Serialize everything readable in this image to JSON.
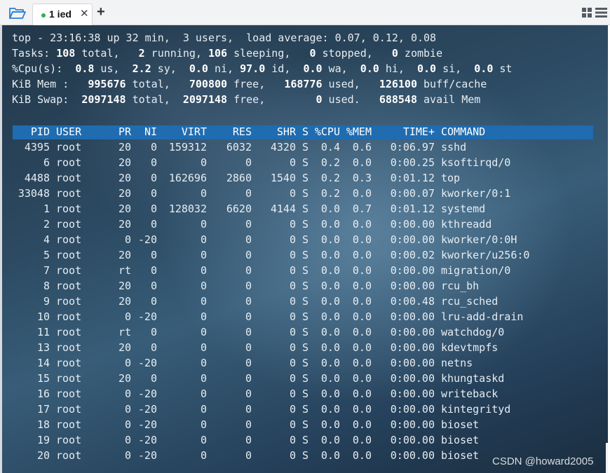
{
  "tabbar": {
    "open_folder_icon": "folder-open-icon",
    "tab_label": "1 ied",
    "tab_close_glyph": "✕",
    "add_tab_glyph": "+",
    "layout_icon": "grid-list-icon",
    "colors": {
      "tab_dot": "#2cb34a",
      "folder_icon": "#2a7fd4"
    }
  },
  "terminal": {
    "summary": [
      "top - 23:16:38 up 32 min,  3 users,  load average: 0.07, 0.12, 0.08",
      "Tasks: 108 total,   2 running, 106 sleeping,   0 stopped,   0 zombie",
      "%Cpu(s):  0.8 us,  2.2 sy,  0.0 ni, 97.0 id,  0.0 wa,  0.0 hi,  0.0 si,  0.0 st",
      "KiB Mem :   995676 total,   700800 free,   168776 used,   126100 buff/cache",
      "KiB Swap:  2097148 total,  2097148 free,        0 used.   688548 avail Mem"
    ],
    "columns": [
      "PID",
      "USER",
      "PR",
      "NI",
      "VIRT",
      "RES",
      "SHR",
      "S",
      "%CPU",
      "%MEM",
      "TIME+",
      "COMMAND"
    ],
    "processes": [
      [
        "4395",
        "root",
        "20",
        "0",
        "159312",
        "6032",
        "4320",
        "S",
        "0.4",
        "0.6",
        "0:06.97",
        "sshd"
      ],
      [
        "6",
        "root",
        "20",
        "0",
        "0",
        "0",
        "0",
        "S",
        "0.2",
        "0.0",
        "0:00.25",
        "ksoftirqd/0"
      ],
      [
        "4488",
        "root",
        "20",
        "0",
        "162696",
        "2860",
        "1540",
        "S",
        "0.2",
        "0.3",
        "0:01.12",
        "top"
      ],
      [
        "33048",
        "root",
        "20",
        "0",
        "0",
        "0",
        "0",
        "S",
        "0.2",
        "0.0",
        "0:00.07",
        "kworker/0:1"
      ],
      [
        "1",
        "root",
        "20",
        "0",
        "128032",
        "6620",
        "4144",
        "S",
        "0.0",
        "0.7",
        "0:01.12",
        "systemd"
      ],
      [
        "2",
        "root",
        "20",
        "0",
        "0",
        "0",
        "0",
        "S",
        "0.0",
        "0.0",
        "0:00.00",
        "kthreadd"
      ],
      [
        "4",
        "root",
        "0",
        "-20",
        "0",
        "0",
        "0",
        "S",
        "0.0",
        "0.0",
        "0:00.00",
        "kworker/0:0H"
      ],
      [
        "5",
        "root",
        "20",
        "0",
        "0",
        "0",
        "0",
        "S",
        "0.0",
        "0.0",
        "0:00.02",
        "kworker/u256:0"
      ],
      [
        "7",
        "root",
        "rt",
        "0",
        "0",
        "0",
        "0",
        "S",
        "0.0",
        "0.0",
        "0:00.00",
        "migration/0"
      ],
      [
        "8",
        "root",
        "20",
        "0",
        "0",
        "0",
        "0",
        "S",
        "0.0",
        "0.0",
        "0:00.00",
        "rcu_bh"
      ],
      [
        "9",
        "root",
        "20",
        "0",
        "0",
        "0",
        "0",
        "S",
        "0.0",
        "0.0",
        "0:00.48",
        "rcu_sched"
      ],
      [
        "10",
        "root",
        "0",
        "-20",
        "0",
        "0",
        "0",
        "S",
        "0.0",
        "0.0",
        "0:00.00",
        "lru-add-drain"
      ],
      [
        "11",
        "root",
        "rt",
        "0",
        "0",
        "0",
        "0",
        "S",
        "0.0",
        "0.0",
        "0:00.00",
        "watchdog/0"
      ],
      [
        "13",
        "root",
        "20",
        "0",
        "0",
        "0",
        "0",
        "S",
        "0.0",
        "0.0",
        "0:00.00",
        "kdevtmpfs"
      ],
      [
        "14",
        "root",
        "0",
        "-20",
        "0",
        "0",
        "0",
        "S",
        "0.0",
        "0.0",
        "0:00.00",
        "netns"
      ],
      [
        "15",
        "root",
        "20",
        "0",
        "0",
        "0",
        "0",
        "S",
        "0.0",
        "0.0",
        "0:00.00",
        "khungtaskd"
      ],
      [
        "16",
        "root",
        "0",
        "-20",
        "0",
        "0",
        "0",
        "S",
        "0.0",
        "0.0",
        "0:00.00",
        "writeback"
      ],
      [
        "17",
        "root",
        "0",
        "-20",
        "0",
        "0",
        "0",
        "S",
        "0.0",
        "0.0",
        "0:00.00",
        "kintegrityd"
      ],
      [
        "18",
        "root",
        "0",
        "-20",
        "0",
        "0",
        "0",
        "S",
        "0.0",
        "0.0",
        "0:00.00",
        "bioset"
      ],
      [
        "19",
        "root",
        "0",
        "-20",
        "0",
        "0",
        "0",
        "S",
        "0.0",
        "0.0",
        "0:00.00",
        "bioset"
      ],
      [
        "20",
        "root",
        "0",
        "-20",
        "0",
        "0",
        "0",
        "S",
        "0.0",
        "0.0",
        "0:00.00",
        "bioset"
      ]
    ],
    "colors": {
      "header_bar": "#1f6cb1",
      "text": "#e6edf2"
    }
  },
  "watermark": "CSDN @howard2005"
}
